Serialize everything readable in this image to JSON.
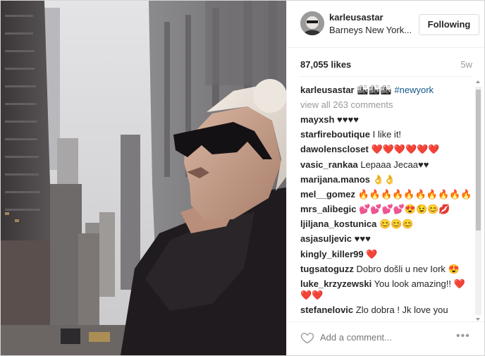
{
  "post": {
    "username": "karleusastar",
    "location": "Barneys New York...",
    "follow_label": "Following",
    "likes": "87,055 likes",
    "time_ago": "5w",
    "caption_user": "karleusastar",
    "caption_emoji": "🏙🏙🏙",
    "caption_tag": "#newyork",
    "view_all": "view all 263 comments",
    "add_comment_placeholder": "Add a comment...",
    "more_label": "•••"
  },
  "comments": [
    {
      "user": "mayxsh",
      "text": "♥♥♥♥"
    },
    {
      "user": "starfireboutique",
      "text": "I like it!"
    },
    {
      "user": "dawolenscloset",
      "text": "❤️❤️❤️❤️❤️❤️"
    },
    {
      "user": "vasic_rankaa",
      "text": "Lepaaa Jecaa♥♥"
    },
    {
      "user": "marijana.manos",
      "text": "👌👌"
    },
    {
      "user": "mel__gomez",
      "text": "🔥🔥🔥🔥🔥🔥🔥🔥🔥🔥"
    },
    {
      "user": "mrs_alibegic",
      "text": "💕💕💕💕😍😉😊💋"
    },
    {
      "user": "ljiljana_kostunica",
      "text": "😊😊😊"
    },
    {
      "user": "asjasuljevic",
      "text": "♥♥♥"
    },
    {
      "user": "kingly_killer99",
      "text": "❤️"
    },
    {
      "user": "tugsatoguzz",
      "text": "Dobro došli u nev Iork 😍"
    },
    {
      "user": "luke_krzyzewski",
      "text": "You look amazing!! ❤️❤️❤️"
    },
    {
      "user": "stefanelovic",
      "text": "Zlo dobra ! Jk love you"
    }
  ]
}
